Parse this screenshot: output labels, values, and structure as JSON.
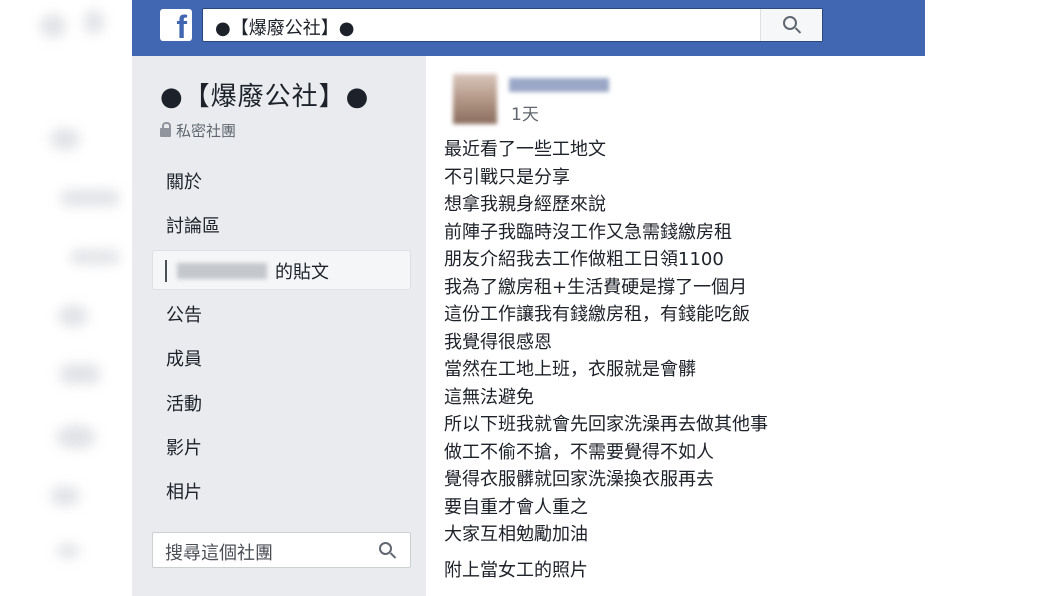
{
  "topbar": {
    "logo": "f",
    "search_value": "●【爆廢公社】●",
    "search_icon": "search-icon"
  },
  "sidebar": {
    "group_name": "●【爆廢公社】●",
    "privacy_label": "私密社團",
    "nav": {
      "about": "關於",
      "discussion": "討論區",
      "member_posts_suffix": "的貼文",
      "announcements": "公告",
      "members": "成員",
      "events": "活動",
      "videos": "影片",
      "photos": "相片"
    },
    "search_placeholder": "搜尋這個社團"
  },
  "post": {
    "time": "1天",
    "lines": [
      "最近看了一些工地文",
      "不引戰只是分享",
      "想拿我親身經歷來說",
      "前陣子我臨時沒工作又急需錢繳房租",
      "朋友介紹我去工作做粗工日領1100",
      "我為了繳房租+生活費硬是撐了一個月",
      "這份工作讓我有錢繳房租，有錢能吃飯",
      "我覺得很感恩",
      "當然在工地上班，衣服就是會髒",
      "這無法避免",
      "所以下班我就會先回家洗澡再去做其他事",
      "做工不偷不搶，不需要覺得不如人",
      "覺得衣服髒就回家洗澡換衣服再去",
      "要自重才會人重之",
      "大家互相勉勵加油"
    ],
    "footer_line": "附上當女工的照片"
  },
  "colors": {
    "topbar": "#4267b2",
    "sidebar_bg": "#e9ebee",
    "text": "#1d2129"
  }
}
